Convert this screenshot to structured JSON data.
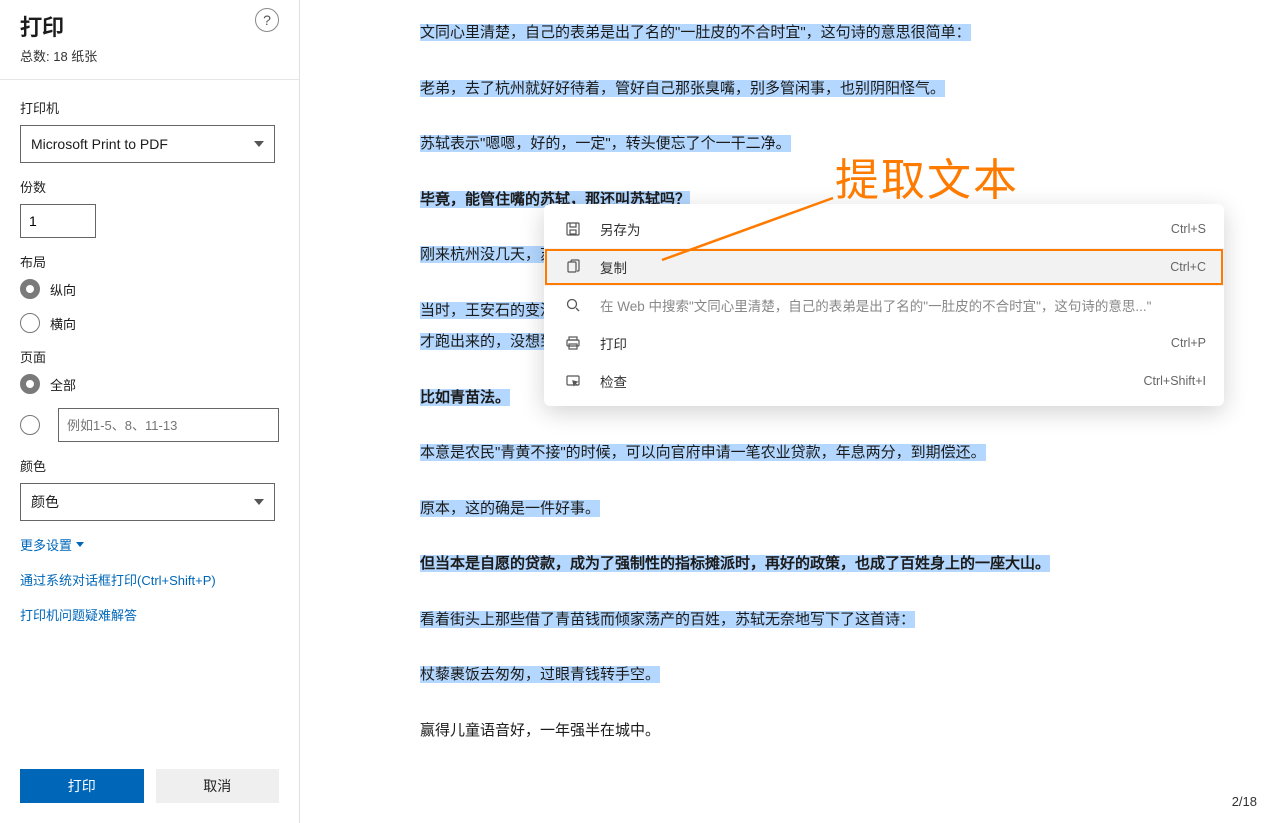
{
  "panel": {
    "title": "打印",
    "total": "总数: 18 纸张",
    "help": "?",
    "printer_label": "打印机",
    "printer_value": "Microsoft Print to PDF",
    "copies_label": "份数",
    "copies_value": "1",
    "layout_label": "布局",
    "layout_portrait": "纵向",
    "layout_landscape": "横向",
    "pages_label": "页面",
    "pages_all": "全部",
    "pages_custom_placeholder": "例如1-5、8、11-13",
    "color_label": "颜色",
    "color_value": "颜色",
    "more_settings": "更多设置",
    "system_dialog": "通过系统对话框打印(Ctrl+Shift+P)",
    "troubleshoot": "打印机问题疑难解答",
    "btn_print": "打印",
    "btn_cancel": "取消"
  },
  "doc": {
    "p1": "文同心里清楚，自己的表弟是出了名的\"一肚皮的不合时宜\"，这句诗的意思很简单：",
    "p2": "老弟，去了杭州就好好待着，管好自己那张臭嘴，别多管闲事，也别阴阳怪气。",
    "p3": "苏轼表示\"嗯嗯，好的，一定\"，转头便忘了个一干二净。",
    "p4": "毕竟，能管住嘴的苏轼，那还叫苏轼吗？",
    "p5": "刚来杭州没几天，苏",
    "p6a": "当时，王安石的变法",
    "p6b": "才跑出来的，没想到",
    "p7": "比如青苗法。",
    "p8": "本意是农民\"青黄不接\"的时候，可以向官府申请一笔农业贷款，年息两分，到期偿还。",
    "p9": "原本，这的确是一件好事。",
    "p10": "但当本是自愿的贷款，成为了强制性的指标摊派时，再好的政策，也成了百姓身上的一座大山。",
    "p11": "看着街头上那些借了青苗钱而倾家荡产的百姓，苏轼无奈地写下了这首诗：",
    "p12": "杖藜裹饭去匆匆，过眼青钱转手空。",
    "p13": "赢得儿童语音好，一年强半在城中。",
    "pagenum": "2/18"
  },
  "ctx": {
    "save_as": "另存为",
    "save_as_sc": "Ctrl+S",
    "copy": "复制",
    "copy_sc": "Ctrl+C",
    "search": "在 Web 中搜索\"文同心里清楚，自己的表弟是出了名的\"一肚皮的不合时宜\"，这句诗的意思...\"",
    "print": "打印",
    "print_sc": "Ctrl+P",
    "inspect": "检查",
    "inspect_sc": "Ctrl+Shift+I"
  },
  "annot": {
    "text": "提取文本"
  }
}
